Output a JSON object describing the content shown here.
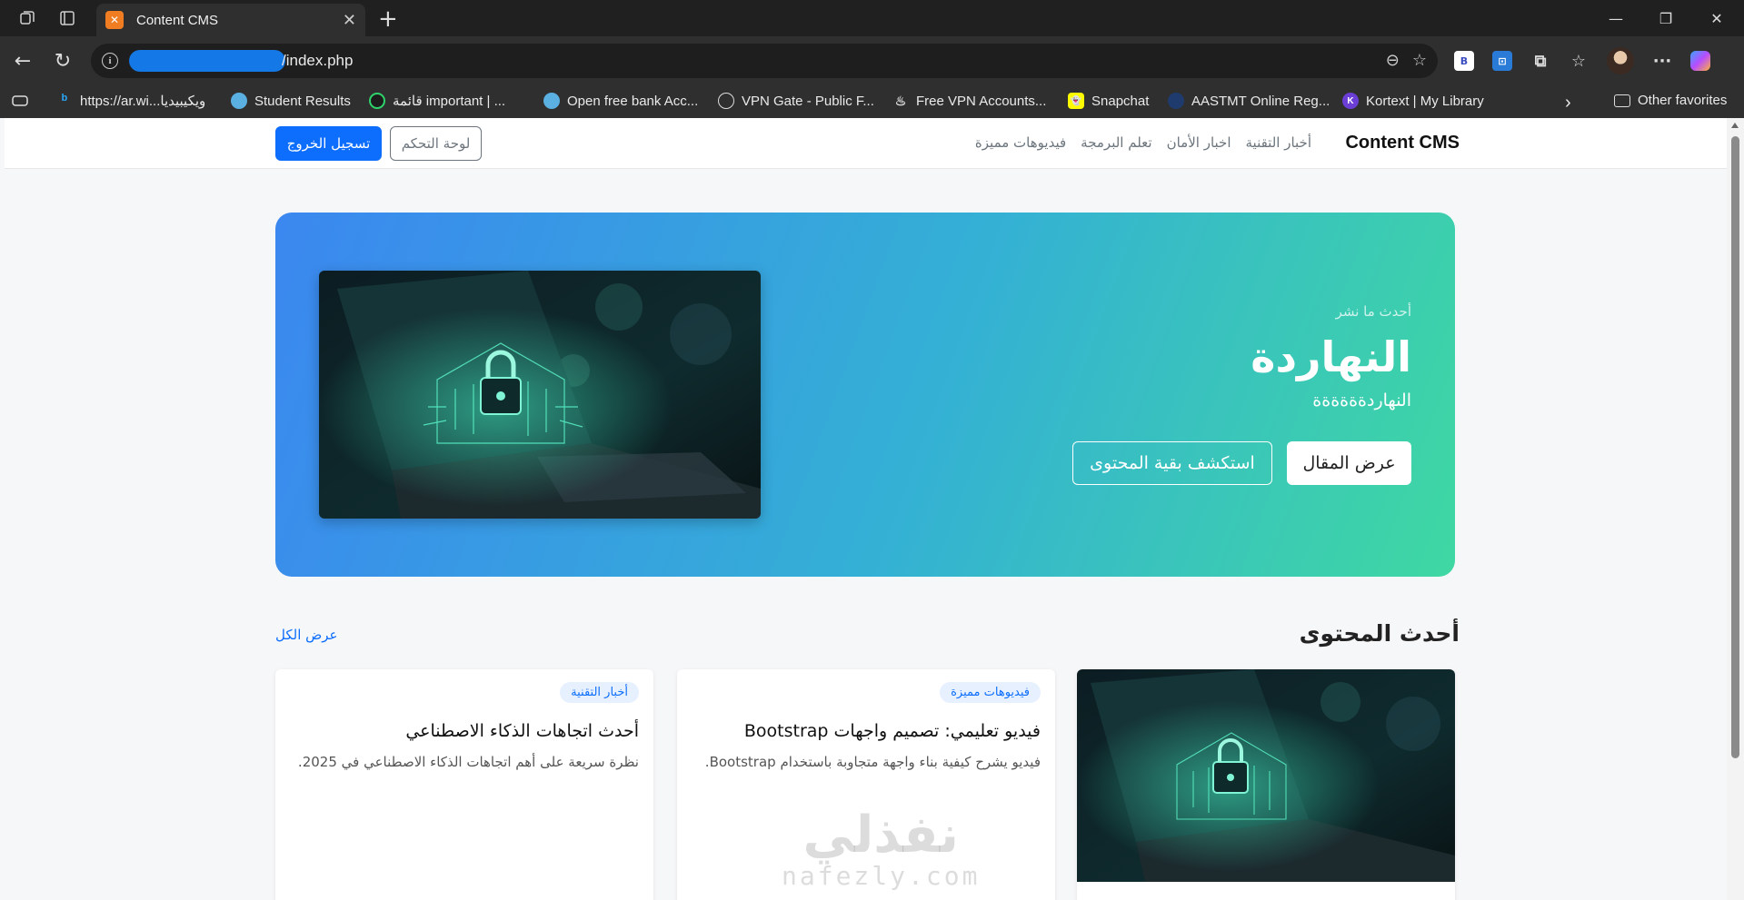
{
  "browser": {
    "tab_title": "Content CMS",
    "url": "/index.php",
    "bookmarks": [
      {
        "label": "https://ar.wi...ويكيبيديا",
        "icon": "bing-icon"
      },
      {
        "label": "Student Results",
        "icon": "globe-icon"
      },
      {
        "label": "قائمة important | ...",
        "icon": "app-icon"
      },
      {
        "label": "Open free bank Acc...",
        "icon": "globe-icon"
      },
      {
        "label": "VPN Gate - Public F...",
        "icon": "globe-icon"
      },
      {
        "label": "Free VPN Accounts...",
        "icon": "flame-icon"
      },
      {
        "label": "Snapchat",
        "icon": "snapchat-icon"
      },
      {
        "label": "AASTMT Online Reg...",
        "icon": "shield-icon"
      },
      {
        "label": "Kortext | My Library",
        "icon": "kortext-icon"
      }
    ],
    "other_favorites": "Other favorites"
  },
  "nav": {
    "brand": "Content CMS",
    "links": [
      "أخبار التقنية",
      "اخبار الأمان",
      "تعلم البرمجة",
      "فيديوهات مميزة"
    ],
    "logout": "تسجيل الخروج",
    "dashboard": "لوحة التحكم"
  },
  "hero": {
    "eyebrow": "أحدث ما نشر",
    "title": "النهاردة",
    "subtitle": "النهاردةةةةةة",
    "btn_view": "عرض المقال",
    "btn_explore": "استكشف بقية المحتوى"
  },
  "section": {
    "title": "أحدث المحتوى",
    "view_all": "عرض الكل"
  },
  "cards": [
    {
      "badge": "أخبار التقنية",
      "title": "أحدث اتجاهات الذكاء الاصطناعي",
      "desc": "نظرة سريعة على أهم اتجاهات الذكاء الاصطناعي في 2025."
    },
    {
      "badge": "فيديوهات مميزة",
      "title": "فيديو تعليمي: تصميم واجهات Bootstrap",
      "desc": "فيديو يشرح كيفية بناء واجهة متجاوبة باستخدام Bootstrap."
    }
  ],
  "watermark": {
    "ar": "نفذلي",
    "en": "nafezly.com"
  },
  "colors": {
    "primary": "#0d6efd",
    "hero_start": "#3b87f0",
    "hero_end": "#3fd8a2"
  }
}
